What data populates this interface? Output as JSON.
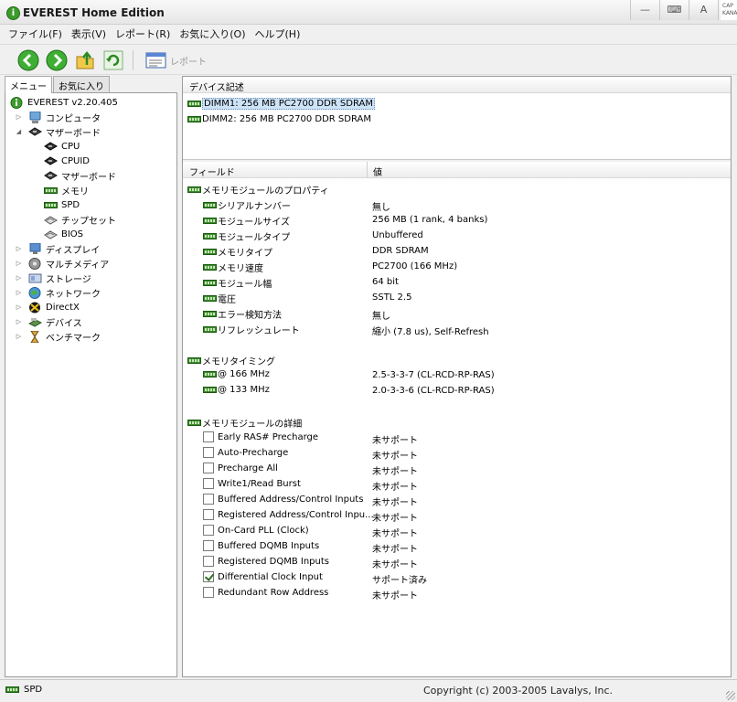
{
  "window": {
    "title": "EVEREST Home Edition",
    "ime_lines": [
      "CAP",
      "KANA"
    ]
  },
  "menu": [
    "ファイル(F)",
    "表示(V)",
    "レポート(R)",
    "お気に入り(O)",
    "ヘルプ(H)"
  ],
  "toolbar": {
    "report_label": "レポート"
  },
  "tabs": [
    "メニュー",
    "お気に入り"
  ],
  "tree": {
    "root": "EVEREST v2.20.405",
    "items": [
      {
        "label": "コンピュータ",
        "icon": "computer-icon"
      },
      {
        "label": "マザーボード",
        "icon": "motherboard-icon"
      },
      {
        "label": "CPU",
        "icon": "cpu-icon"
      },
      {
        "label": "CPUID",
        "icon": "cpuid-icon"
      },
      {
        "label": "マザーボード",
        "icon": "motherboard-icon"
      },
      {
        "label": "メモリ",
        "icon": "memory-icon"
      },
      {
        "label": "SPD",
        "icon": "memory-icon"
      },
      {
        "label": "チップセット",
        "icon": "chipset-icon"
      },
      {
        "label": "BIOS",
        "icon": "bios-icon"
      },
      {
        "label": "ディスプレイ",
        "icon": "display-icon"
      },
      {
        "label": "マルチメディア",
        "icon": "multimedia-icon"
      },
      {
        "label": "ストレージ",
        "icon": "storage-icon"
      },
      {
        "label": "ネットワーク",
        "icon": "network-icon"
      },
      {
        "label": "DirectX",
        "icon": "directx-icon"
      },
      {
        "label": "デバイス",
        "icon": "devices-icon"
      },
      {
        "label": "ベンチマーク",
        "icon": "benchmark-icon"
      }
    ]
  },
  "device_header": "デバイス記述",
  "devices": [
    "DIMM1: 256 MB PC2700 DDR SDRAM",
    "DIMM2: 256 MB PC2700 DDR SDRAM"
  ],
  "columns": {
    "field": "フィールド",
    "value": "値"
  },
  "groups": [
    {
      "title": "メモリモジュールのプロパティ",
      "rows": [
        {
          "field": "シリアルナンバー",
          "value": "無し"
        },
        {
          "field": "モジュールサイズ",
          "value": "256 MB (1 rank, 4 banks)"
        },
        {
          "field": "モジュールタイプ",
          "value": "Unbuffered"
        },
        {
          "field": "メモリタイプ",
          "value": "DDR SDRAM"
        },
        {
          "field": "メモリ速度",
          "value": "PC2700 (166 MHz)"
        },
        {
          "field": "モジュール幅",
          "value": "64 bit"
        },
        {
          "field": "電圧",
          "value": "SSTL 2.5"
        },
        {
          "field": "エラー検知方法",
          "value": "無し"
        },
        {
          "field": "リフレッシュレート",
          "value": "縮小 (7.8 us), Self-Refresh"
        }
      ]
    },
    {
      "title": "メモリタイミング",
      "rows": [
        {
          "field": "@ 166 MHz",
          "value": "2.5-3-3-7  (CL-RCD-RP-RAS)"
        },
        {
          "field": "@ 133 MHz",
          "value": "2.0-3-3-6  (CL-RCD-RP-RAS)"
        }
      ]
    },
    {
      "title": "メモリモジュールの詳細",
      "checks": [
        {
          "field": "Early RAS# Precharge",
          "value": "未サポート",
          "checked": false
        },
        {
          "field": "Auto-Precharge",
          "value": "未サポート",
          "checked": false
        },
        {
          "field": "Precharge All",
          "value": "未サポート",
          "checked": false
        },
        {
          "field": "Write1/Read Burst",
          "value": "未サポート",
          "checked": false
        },
        {
          "field": "Buffered Address/Control Inputs",
          "value": "未サポート",
          "checked": false
        },
        {
          "field": "Registered Address/Control Inpu...",
          "value": "未サポート",
          "checked": false
        },
        {
          "field": "On-Card PLL (Clock)",
          "value": "未サポート",
          "checked": false
        },
        {
          "field": "Buffered DQMB Inputs",
          "value": "未サポート",
          "checked": false
        },
        {
          "field": "Registered DQMB Inputs",
          "value": "未サポート",
          "checked": false
        },
        {
          "field": "Differential Clock Input",
          "value": "サポート済み",
          "checked": true
        },
        {
          "field": "Redundant Row Address",
          "value": "未サポート",
          "checked": false
        }
      ]
    }
  ],
  "status": {
    "left": "SPD",
    "right": "Copyright (c) 2003-2005 Lavalys, Inc."
  }
}
